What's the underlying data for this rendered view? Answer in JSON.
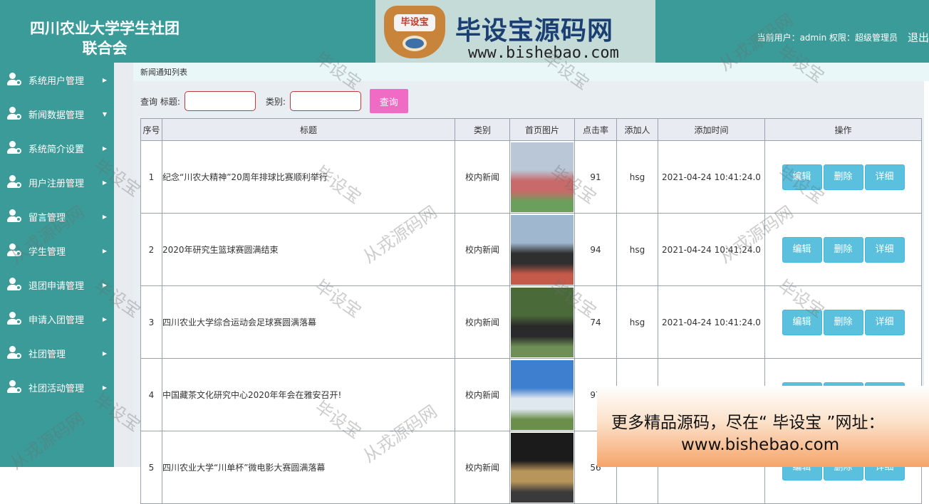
{
  "header": {
    "title_line1": "四川农业大学学生社团",
    "title_line2": "联合会",
    "logo_badge": "毕设宝",
    "logo_name": "毕设宝源码网",
    "logo_url": "www.bishebao.com",
    "user_info": "当前用户：admin  权限：超级管理员",
    "logout": "退出"
  },
  "sidebar": {
    "items": [
      {
        "label": "系统用户管理",
        "icon": "user-gear-icon",
        "arrow": "▶"
      },
      {
        "label": "新闻数据管理",
        "icon": "user-gear-icon",
        "arrow": "▼"
      },
      {
        "label": "系统简介设置",
        "icon": "user-gear-icon",
        "arrow": "▶"
      },
      {
        "label": "用户注册管理",
        "icon": "user-gear-icon",
        "arrow": "▶"
      },
      {
        "label": "留言管理",
        "icon": "user-gear-icon",
        "arrow": "▶"
      },
      {
        "label": "学生管理",
        "icon": "user-gear-icon",
        "arrow": "▶"
      },
      {
        "label": "退团申请管理",
        "icon": "user-gear-icon",
        "arrow": "▶"
      },
      {
        "label": "申请入团管理",
        "icon": "user-gear-icon",
        "arrow": "▶"
      },
      {
        "label": "社团管理",
        "icon": "user-gear-icon",
        "arrow": "▶"
      },
      {
        "label": "社团活动管理",
        "icon": "user-gear-icon",
        "arrow": "▶"
      }
    ]
  },
  "breadcrumb": "新闻通知列表",
  "search": {
    "title_label": "查询 标题:",
    "title_value": "",
    "category_label": "类别:",
    "category_value": "",
    "button": "查询"
  },
  "table": {
    "headers": [
      "序号",
      "标题",
      "类别",
      "首页图片",
      "点击率",
      "添加人",
      "添加时间",
      "操作"
    ],
    "rows": [
      {
        "no": "1",
        "title": "纪念“川农大精神”20周年排球比赛顺利举行",
        "category": "校内新闻",
        "clicks": "91",
        "author": "hsg",
        "time": "2021-04-24 10:41:24.0",
        "thumb_colors": [
          "#b9c7d6",
          "#c86a6a",
          "#6aa05b"
        ]
      },
      {
        "no": "2",
        "title": "2020年研究生篮球赛圆满结束",
        "category": "校内新闻",
        "clicks": "94",
        "author": "hsg",
        "time": "2021-04-24 10:41:24.0",
        "thumb_colors": [
          "#9fb8cf",
          "#2f2f2f",
          "#c65a4a"
        ]
      },
      {
        "no": "3",
        "title": "四川农业大学综合运动会足球赛圆满落幕",
        "category": "校内新闻",
        "clicks": "74",
        "author": "hsg",
        "time": "2021-04-24 10:41:24.0",
        "thumb_colors": [
          "#4b6a3a",
          "#2a2a2a",
          "#6e8f55"
        ]
      },
      {
        "no": "4",
        "title": "中国藏茶文化研究中心2020年年会在雅安召开!",
        "category": "校内新闻",
        "clicks": "97",
        "author": "",
        "time": "",
        "thumb_colors": [
          "#3e7fd0",
          "#dfe7ef",
          "#6b8f4a"
        ]
      },
      {
        "no": "5",
        "title": "四川农业大学“川单杯”微电影大赛圆满落幕",
        "category": "校内新闻",
        "clicks": "56",
        "author": "",
        "time": "",
        "thumb_colors": [
          "#1b1b1b",
          "#b8955a",
          "#3a3a3a"
        ]
      }
    ],
    "actions": {
      "edit": "编辑",
      "delete": "删除",
      "detail": "详细"
    }
  },
  "promo": {
    "line1": "更多精品源码，尽在“ 毕设宝 ”网址：",
    "line2": "www.bishebao.com"
  },
  "watermarks": [
    "毕设宝",
    "从戎源码网"
  ]
}
